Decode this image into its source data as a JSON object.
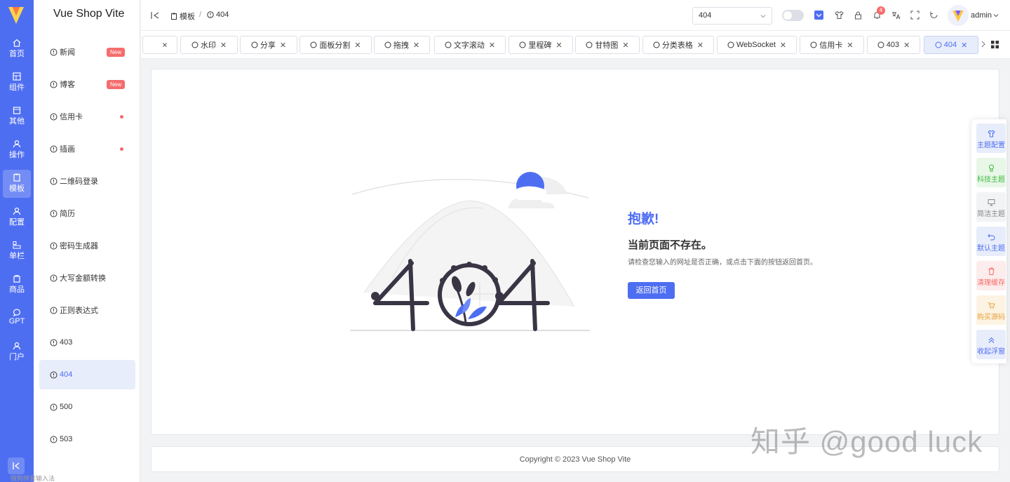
{
  "app": {
    "brand": "Vue Shop Vite"
  },
  "rail": {
    "items": [
      {
        "label": "首页",
        "icon": "home-icon"
      },
      {
        "label": "组件",
        "icon": "component-icon"
      },
      {
        "label": "其他",
        "icon": "box-icon"
      },
      {
        "label": "操作",
        "icon": "operation-icon"
      },
      {
        "label": "模板",
        "icon": "template-icon",
        "active": true
      },
      {
        "label": "配置",
        "icon": "config-icon"
      },
      {
        "label": "单栏",
        "icon": "single-column-icon"
      },
      {
        "label": "商品",
        "icon": "goods-icon"
      },
      {
        "label": "GPT",
        "icon": "chat-icon"
      },
      {
        "label": "门户",
        "icon": "portal-icon"
      }
    ]
  },
  "submenu": {
    "items": [
      {
        "label": "新闻",
        "badge": "New"
      },
      {
        "label": "博客",
        "badge": "New"
      },
      {
        "label": "信用卡",
        "dot": true
      },
      {
        "label": "插画",
        "dot": true
      },
      {
        "label": "二维码登录"
      },
      {
        "label": "简历"
      },
      {
        "label": "密码生成器"
      },
      {
        "label": "大写金额转换"
      },
      {
        "label": "正则表达式"
      },
      {
        "label": "403"
      },
      {
        "label": "404",
        "active": true
      },
      {
        "label": "500"
      },
      {
        "label": "503"
      }
    ]
  },
  "header": {
    "breadcrumb": [
      "模板",
      "404"
    ],
    "breadcrumb_sep": "/",
    "search_value": "404",
    "notifications": "4",
    "username": "admin"
  },
  "tabs": [
    {
      "label": "水印"
    },
    {
      "label": "分享"
    },
    {
      "label": "面板分割"
    },
    {
      "label": "拖拽"
    },
    {
      "label": "文字滚动"
    },
    {
      "label": "里程碑"
    },
    {
      "label": "甘特图"
    },
    {
      "label": "分类表格"
    },
    {
      "label": "WebSocket"
    },
    {
      "label": "信用卡"
    },
    {
      "label": "403"
    },
    {
      "label": "404",
      "active": true
    }
  ],
  "error_page": {
    "title": "抱歉!",
    "message": "当前页面不存在。",
    "hint": "请检查您输入的网址是否正确，或点击下面的按钮返回首页。",
    "button": "返回首页"
  },
  "footer": {
    "copyright": "Copyright © 2023 Vue Shop Vite"
  },
  "float_panel": {
    "items": [
      {
        "label": "主题配置",
        "color": "#4e6ef2",
        "bg": "#e8edfb"
      },
      {
        "label": "科技主题",
        "color": "#3fb93f",
        "bg": "#e8f7e8"
      },
      {
        "label": "简洁主题",
        "color": "#888888",
        "bg": "#f2f3f5"
      },
      {
        "label": "默认主题",
        "color": "#4e6ef2",
        "bg": "#e8edfb"
      },
      {
        "label": "清理缓存",
        "color": "#f56c6c",
        "bg": "#fdecec"
      },
      {
        "label": "购买源码",
        "color": "#e6a23c",
        "bg": "#fdf3e3"
      },
      {
        "label": "收起浮窗",
        "color": "#4e6ef2",
        "bg": "#e8edfb"
      }
    ]
  },
  "watermark": "知乎 @good luck",
  "ime_hint": "搜狗拼音输入法",
  "colors": {
    "primary": "#4e6ef2",
    "danger": "#f56c6c"
  }
}
